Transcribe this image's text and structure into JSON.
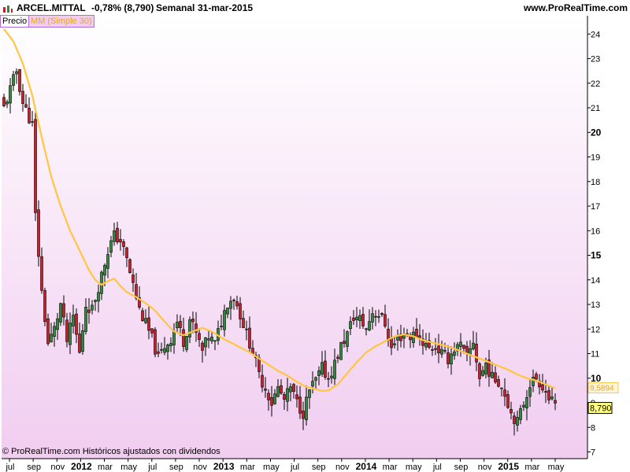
{
  "header": {
    "symbol": "ARCEL.MITTAL",
    "change": "-0,78% (8,790)",
    "period": "Semanal",
    "date": "31-mar-2015",
    "site": "www.ProRealTime.com"
  },
  "legend": {
    "price_label": "Precio",
    "ma_label": "MM (Simple 30)"
  },
  "footer": {
    "copyright": "© ProRealTime.com  Históricos ajustados con dividendos"
  },
  "colors": {
    "background_top": "#ffffff",
    "background_bottom": "#f1cdf0",
    "up_candle": "#2e8b3a",
    "down_candle": "#cc1f2a",
    "moving_average": "#ffc640",
    "ma_label_text": "#e6a81e",
    "last_price_box": "#ffff80"
  },
  "chart_data": {
    "type": "candlestick",
    "series": [
      {
        "name": "Precio",
        "kind": "candlestick"
      },
      {
        "name": "MM (Simple 30)",
        "kind": "line"
      }
    ],
    "y_axis": {
      "range": [
        6.8,
        25.2
      ],
      "ticks": [
        7,
        8,
        9,
        10,
        11,
        12,
        13,
        14,
        15,
        16,
        17,
        18,
        19,
        20,
        21,
        22,
        23,
        24
      ],
      "bold_ticks": [
        10,
        15,
        20
      ],
      "position": "right"
    },
    "x_axis": {
      "tick_labels": [
        "jul",
        "sep",
        "nov",
        "2012",
        "mar",
        "may",
        "jul",
        "sep",
        "nov",
        "2013",
        "mar",
        "may",
        "jul",
        "sep",
        "nov",
        "2014",
        "mar",
        "may",
        "jul",
        "sep",
        "nov",
        "2015",
        "mar",
        "may"
      ],
      "bold_labels": [
        "2012",
        "2013",
        "2014",
        "2015"
      ],
      "first_week": "2011-07-04",
      "last_week": "2015-03-30"
    },
    "close_anchors": [
      [
        0,
        21.0
      ],
      [
        4,
        22.5
      ],
      [
        6,
        21.2
      ],
      [
        9,
        20.3
      ],
      [
        10,
        16.6
      ],
      [
        12,
        13.5
      ],
      [
        14,
        11.4
      ],
      [
        16,
        12.0
      ],
      [
        18,
        13.0
      ],
      [
        20,
        11.5
      ],
      [
        22,
        12.5
      ],
      [
        24,
        11.0
      ],
      [
        26,
        13.0
      ],
      [
        28,
        12.8
      ],
      [
        31,
        14.2
      ],
      [
        33,
        15.2
      ],
      [
        35,
        15.8
      ],
      [
        37,
        15.6
      ],
      [
        39,
        14.8
      ],
      [
        41,
        13.8
      ],
      [
        43,
        12.8
      ],
      [
        45,
        12.2
      ],
      [
        47,
        11.6
      ],
      [
        49,
        10.8
      ],
      [
        51,
        11.3
      ],
      [
        53,
        11.6
      ],
      [
        55,
        12.3
      ],
      [
        57,
        11.5
      ],
      [
        59,
        12.4
      ],
      [
        61,
        11.8
      ],
      [
        63,
        11.1
      ],
      [
        65,
        11.7
      ],
      [
        67,
        11.4
      ],
      [
        69,
        12.3
      ],
      [
        71,
        13.1
      ],
      [
        73,
        13.3
      ],
      [
        75,
        12.6
      ],
      [
        77,
        11.8
      ],
      [
        79,
        11.1
      ],
      [
        81,
        10.1
      ],
      [
        83,
        9.6
      ],
      [
        85,
        9.0
      ],
      [
        87,
        9.6
      ],
      [
        89,
        9.1
      ],
      [
        91,
        9.6
      ],
      [
        93,
        9.0
      ],
      [
        95,
        8.6
      ],
      [
        97,
        9.5
      ],
      [
        99,
        9.9
      ],
      [
        101,
        10.4
      ],
      [
        103,
        10.0
      ],
      [
        105,
        10.6
      ],
      [
        107,
        11.3
      ],
      [
        109,
        11.8
      ],
      [
        111,
        12.5
      ],
      [
        113,
        12.4
      ],
      [
        115,
        12.0
      ],
      [
        117,
        12.7
      ],
      [
        119,
        12.6
      ],
      [
        121,
        12.2
      ],
      [
        123,
        11.2
      ],
      [
        125,
        11.6
      ],
      [
        127,
        11.8
      ],
      [
        129,
        11.7
      ],
      [
        131,
        11.8
      ],
      [
        133,
        11.5
      ],
      [
        135,
        11.2
      ],
      [
        137,
        11.3
      ],
      [
        139,
        11.0
      ],
      [
        141,
        10.8
      ],
      [
        143,
        11.2
      ],
      [
        145,
        11.3
      ],
      [
        147,
        10.8
      ],
      [
        149,
        11.5
      ],
      [
        151,
        10.0
      ],
      [
        153,
        10.6
      ],
      [
        155,
        10.0
      ],
      [
        157,
        9.9
      ],
      [
        159,
        9.4
      ],
      [
        161,
        8.6
      ],
      [
        163,
        8.2
      ],
      [
        165,
        9.0
      ],
      [
        167,
        9.8
      ],
      [
        169,
        10.0
      ],
      [
        171,
        9.7
      ],
      [
        173,
        9.2
      ],
      [
        175,
        8.79
      ]
    ],
    "moving_average_anchors": [
      [
        0,
        24.2
      ],
      [
        3,
        23.7
      ],
      [
        6,
        22.8
      ],
      [
        9,
        21.5
      ],
      [
        12,
        19.8
      ],
      [
        15,
        18.2
      ],
      [
        18,
        17.0
      ],
      [
        21,
        16.0
      ],
      [
        24,
        15.2
      ],
      [
        27,
        14.4
      ],
      [
        29,
        14.0
      ],
      [
        31,
        13.8
      ],
      [
        33,
        13.95
      ],
      [
        35,
        14.05
      ],
      [
        37,
        13.75
      ],
      [
        39,
        13.5
      ],
      [
        42,
        13.3
      ],
      [
        45,
        13.05
      ],
      [
        48,
        12.75
      ],
      [
        51,
        12.3
      ],
      [
        54,
        11.9
      ],
      [
        57,
        11.75
      ],
      [
        60,
        11.9
      ],
      [
        63,
        12.05
      ],
      [
        66,
        11.9
      ],
      [
        69,
        11.65
      ],
      [
        72,
        11.45
      ],
      [
        75,
        11.25
      ],
      [
        78,
        11.05
      ],
      [
        81,
        10.8
      ],
      [
        84,
        10.55
      ],
      [
        87,
        10.3
      ],
      [
        90,
        10.1
      ],
      [
        93,
        9.85
      ],
      [
        96,
        9.65
      ],
      [
        99,
        9.55
      ],
      [
        101,
        9.48
      ],
      [
        103,
        9.5
      ],
      [
        106,
        9.75
      ],
      [
        109,
        10.2
      ],
      [
        112,
        10.65
      ],
      [
        115,
        11.05
      ],
      [
        118,
        11.3
      ],
      [
        121,
        11.5
      ],
      [
        124,
        11.7
      ],
      [
        127,
        11.78
      ],
      [
        130,
        11.7
      ],
      [
        133,
        11.55
      ],
      [
        136,
        11.45
      ],
      [
        139,
        11.35
      ],
      [
        142,
        11.25
      ],
      [
        145,
        11.1
      ],
      [
        148,
        10.95
      ],
      [
        151,
        10.8
      ],
      [
        154,
        10.65
      ],
      [
        157,
        10.5
      ],
      [
        160,
        10.35
      ],
      [
        163,
        10.15
      ],
      [
        166,
        10.0
      ],
      [
        169,
        9.9
      ],
      [
        172,
        9.75
      ],
      [
        175,
        9.59
      ]
    ],
    "last_values": {
      "price": "8,790",
      "moving_average": "9,5894"
    },
    "grid": false,
    "legend_placement": "top-left"
  }
}
